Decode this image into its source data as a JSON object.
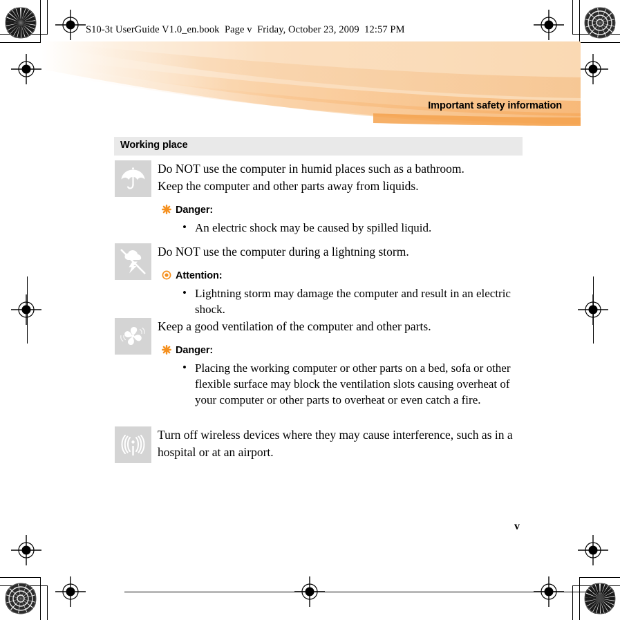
{
  "file_header": "S10-3t UserGuide V1.0_en.book  Page v  Friday, October 23, 2009  12:57 PM",
  "banner": {
    "title": "Important safety information",
    "color_light": "#fdeedb",
    "color_mid": "#fad9b5",
    "color_deep": "#f8b777"
  },
  "section": {
    "heading": "Working place",
    "bar_color": "#e9e9e9"
  },
  "blocks": [
    {
      "icon": "umbrella-icon",
      "paragraphs": [
        "Do NOT use the computer in humid places such as a bathroom.",
        "Keep the computer and other parts away from liquids."
      ],
      "notice": {
        "marker": "danger-asterisk-icon",
        "label": "Danger:",
        "items": [
          "An electric shock may be caused by spilled liquid."
        ]
      }
    },
    {
      "icon": "no-lightning-storm-icon",
      "paragraphs": [
        "Do NOT use the computer during a lightning storm."
      ],
      "notice": {
        "marker": "attention-dot-icon",
        "label": "Attention:",
        "items": [
          "Lightning storm may damage the computer and result in an electric shock."
        ]
      }
    },
    {
      "icon": "fan-ventilation-icon",
      "paragraphs": [
        "Keep a good ventilation of the computer and other parts."
      ],
      "notice": {
        "marker": "danger-asterisk-icon",
        "label": "Danger:",
        "items": [
          "Placing the working computer or other parts on a bed, sofa or other flexible surface may block the ventilation slots causing overheat of your computer or other parts to overheat or even catch a fire."
        ]
      }
    },
    {
      "icon": "wireless-antenna-icon",
      "paragraphs": [
        "Turn off wireless devices where they may cause interference, such as in a hospital or at an airport."
      ],
      "notice": null
    }
  ],
  "page_number": "v",
  "marker_color": "#f5901e",
  "icon_bg_color": "#d4d4d4"
}
